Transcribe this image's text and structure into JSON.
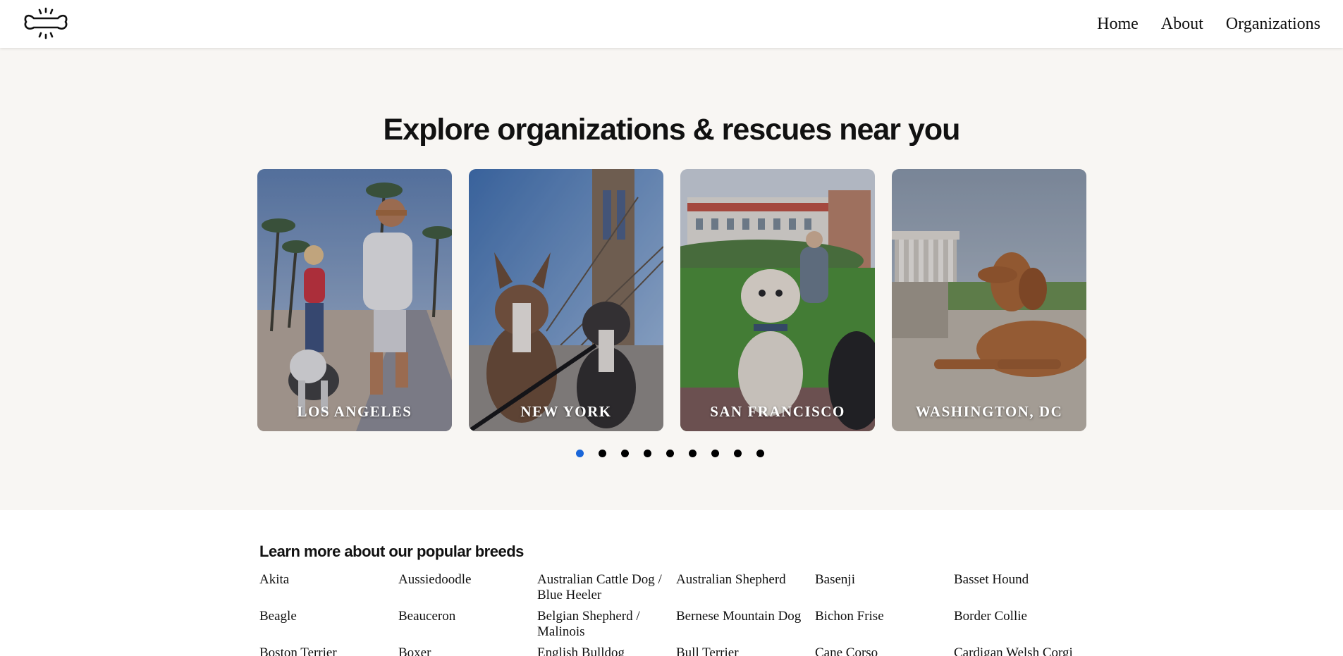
{
  "header": {
    "logo_icon": "dog-bone-icon",
    "nav": [
      {
        "label": "Home"
      },
      {
        "label": "About"
      },
      {
        "label": "Organizations"
      }
    ]
  },
  "hero": {
    "title": "Explore organizations & rescues near you",
    "cities": [
      {
        "label": "Los Angeles"
      },
      {
        "label": "New York"
      },
      {
        "label": "San Francisco"
      },
      {
        "label": "Washington, DC"
      }
    ],
    "carousel": {
      "total_dots": 9,
      "active_index": 0,
      "active_color": "#1a66d9"
    }
  },
  "breeds": {
    "title": "Learn more about our popular breeds",
    "items": [
      "Akita",
      "Aussiedoodle",
      "Australian Cattle Dog / Blue Heeler",
      "Australian Shepherd",
      "Basenji",
      "Basset Hound",
      "Beagle",
      "Beauceron",
      "Belgian Shepherd / Malinois",
      "Bernese Mountain Dog",
      "Bichon Frise",
      "Border Collie",
      "Boston Terrier",
      "Boxer",
      "English Bulldog",
      "Bull Terrier",
      "Cane Corso",
      "Cardigan Welsh Corgi"
    ]
  },
  "colors": {
    "hero_bg": "#f8f6f3",
    "page_bg": "#ffffff",
    "text": "#111111"
  }
}
